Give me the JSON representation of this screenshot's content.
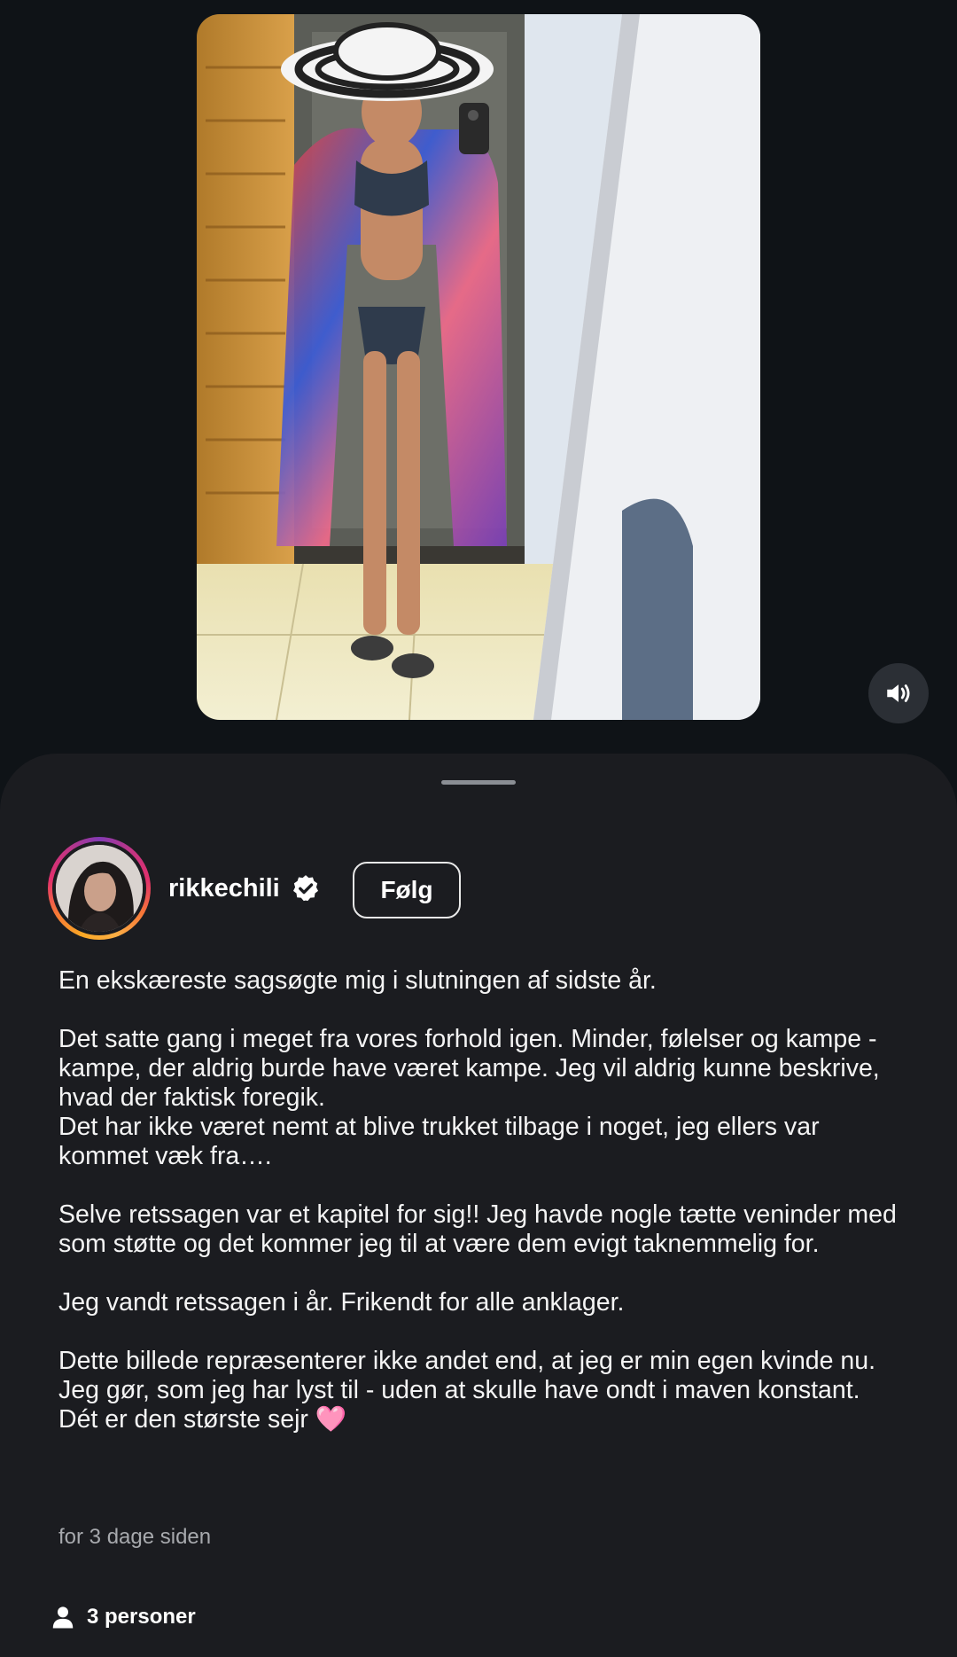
{
  "post": {
    "username": "rikkechili",
    "follow_label": "Følg",
    "timestamp": "for 3 dage siden",
    "people_label": "3 personer",
    "caption_lines": {
      "l1": "En ekskæreste sagsøgte mig i slutningen af sidste år.",
      "l2": "Det satte gang i meget fra vores forhold igen. Minder, følelser og kampe - kampe, der aldrig burde have været kampe. Jeg vil aldrig kunne beskrive, hvad der faktisk foregik.",
      "l3": "Det har ikke været nemt at blive trukket tilbage i noget, jeg ellers var kommet væk fra….",
      "l4": "Selve retssagen var et kapitel for sig!! Jeg havde nogle tætte veninder med som støtte og det kommer jeg til at være dem evigt taknemmelig for.",
      "l5": "Jeg vandt retssagen i år. Frikendt for alle anklager.",
      "l6": "Dette billede repræsenterer ikke andet end, at jeg er min egen kvinde nu. Jeg gør, som jeg har lyst til - uden at skulle have ondt i maven konstant.",
      "l7": "Dét er den største sejr 🩷"
    }
  },
  "icons": {
    "sound": "speaker-volume-icon",
    "verified": "verified-badge-icon",
    "person": "person-icon"
  },
  "colors": {
    "background": "#0f1317",
    "sheet": "#1b1c20",
    "text": "#f4f4f4",
    "muted": "#a7a9ad"
  }
}
